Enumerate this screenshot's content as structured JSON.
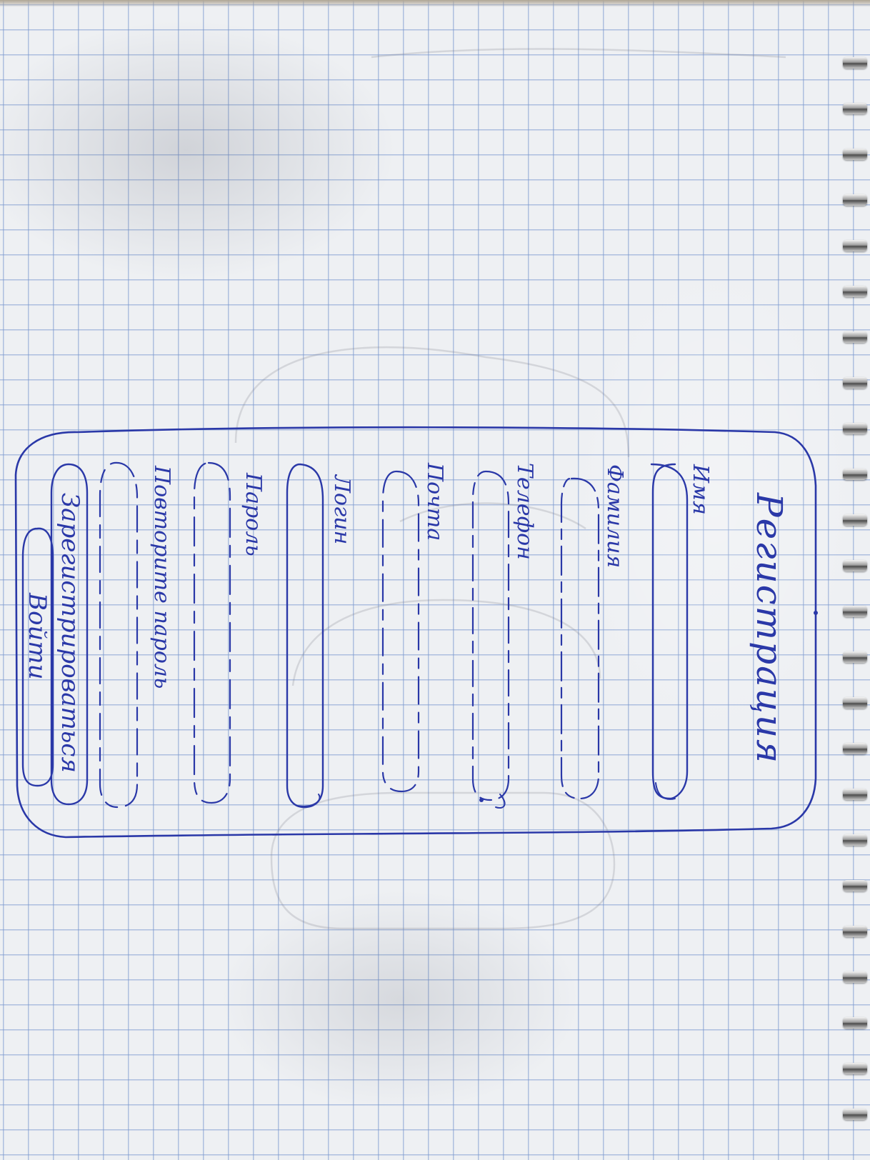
{
  "sketch": {
    "title": "Регистрация",
    "fields": [
      {
        "label": "Имя"
      },
      {
        "label": "Фамилия"
      },
      {
        "label": "Телефон"
      },
      {
        "label": "Почта"
      },
      {
        "label": "Логин"
      },
      {
        "label": "Пароль"
      },
      {
        "label": "Повторите пароль"
      }
    ],
    "register_button": "Зарегистрироваться",
    "login_button": "Войти"
  },
  "colors": {
    "ink": "#2a38a8",
    "paper": "#eef0f3",
    "grid": "#7896cd"
  }
}
